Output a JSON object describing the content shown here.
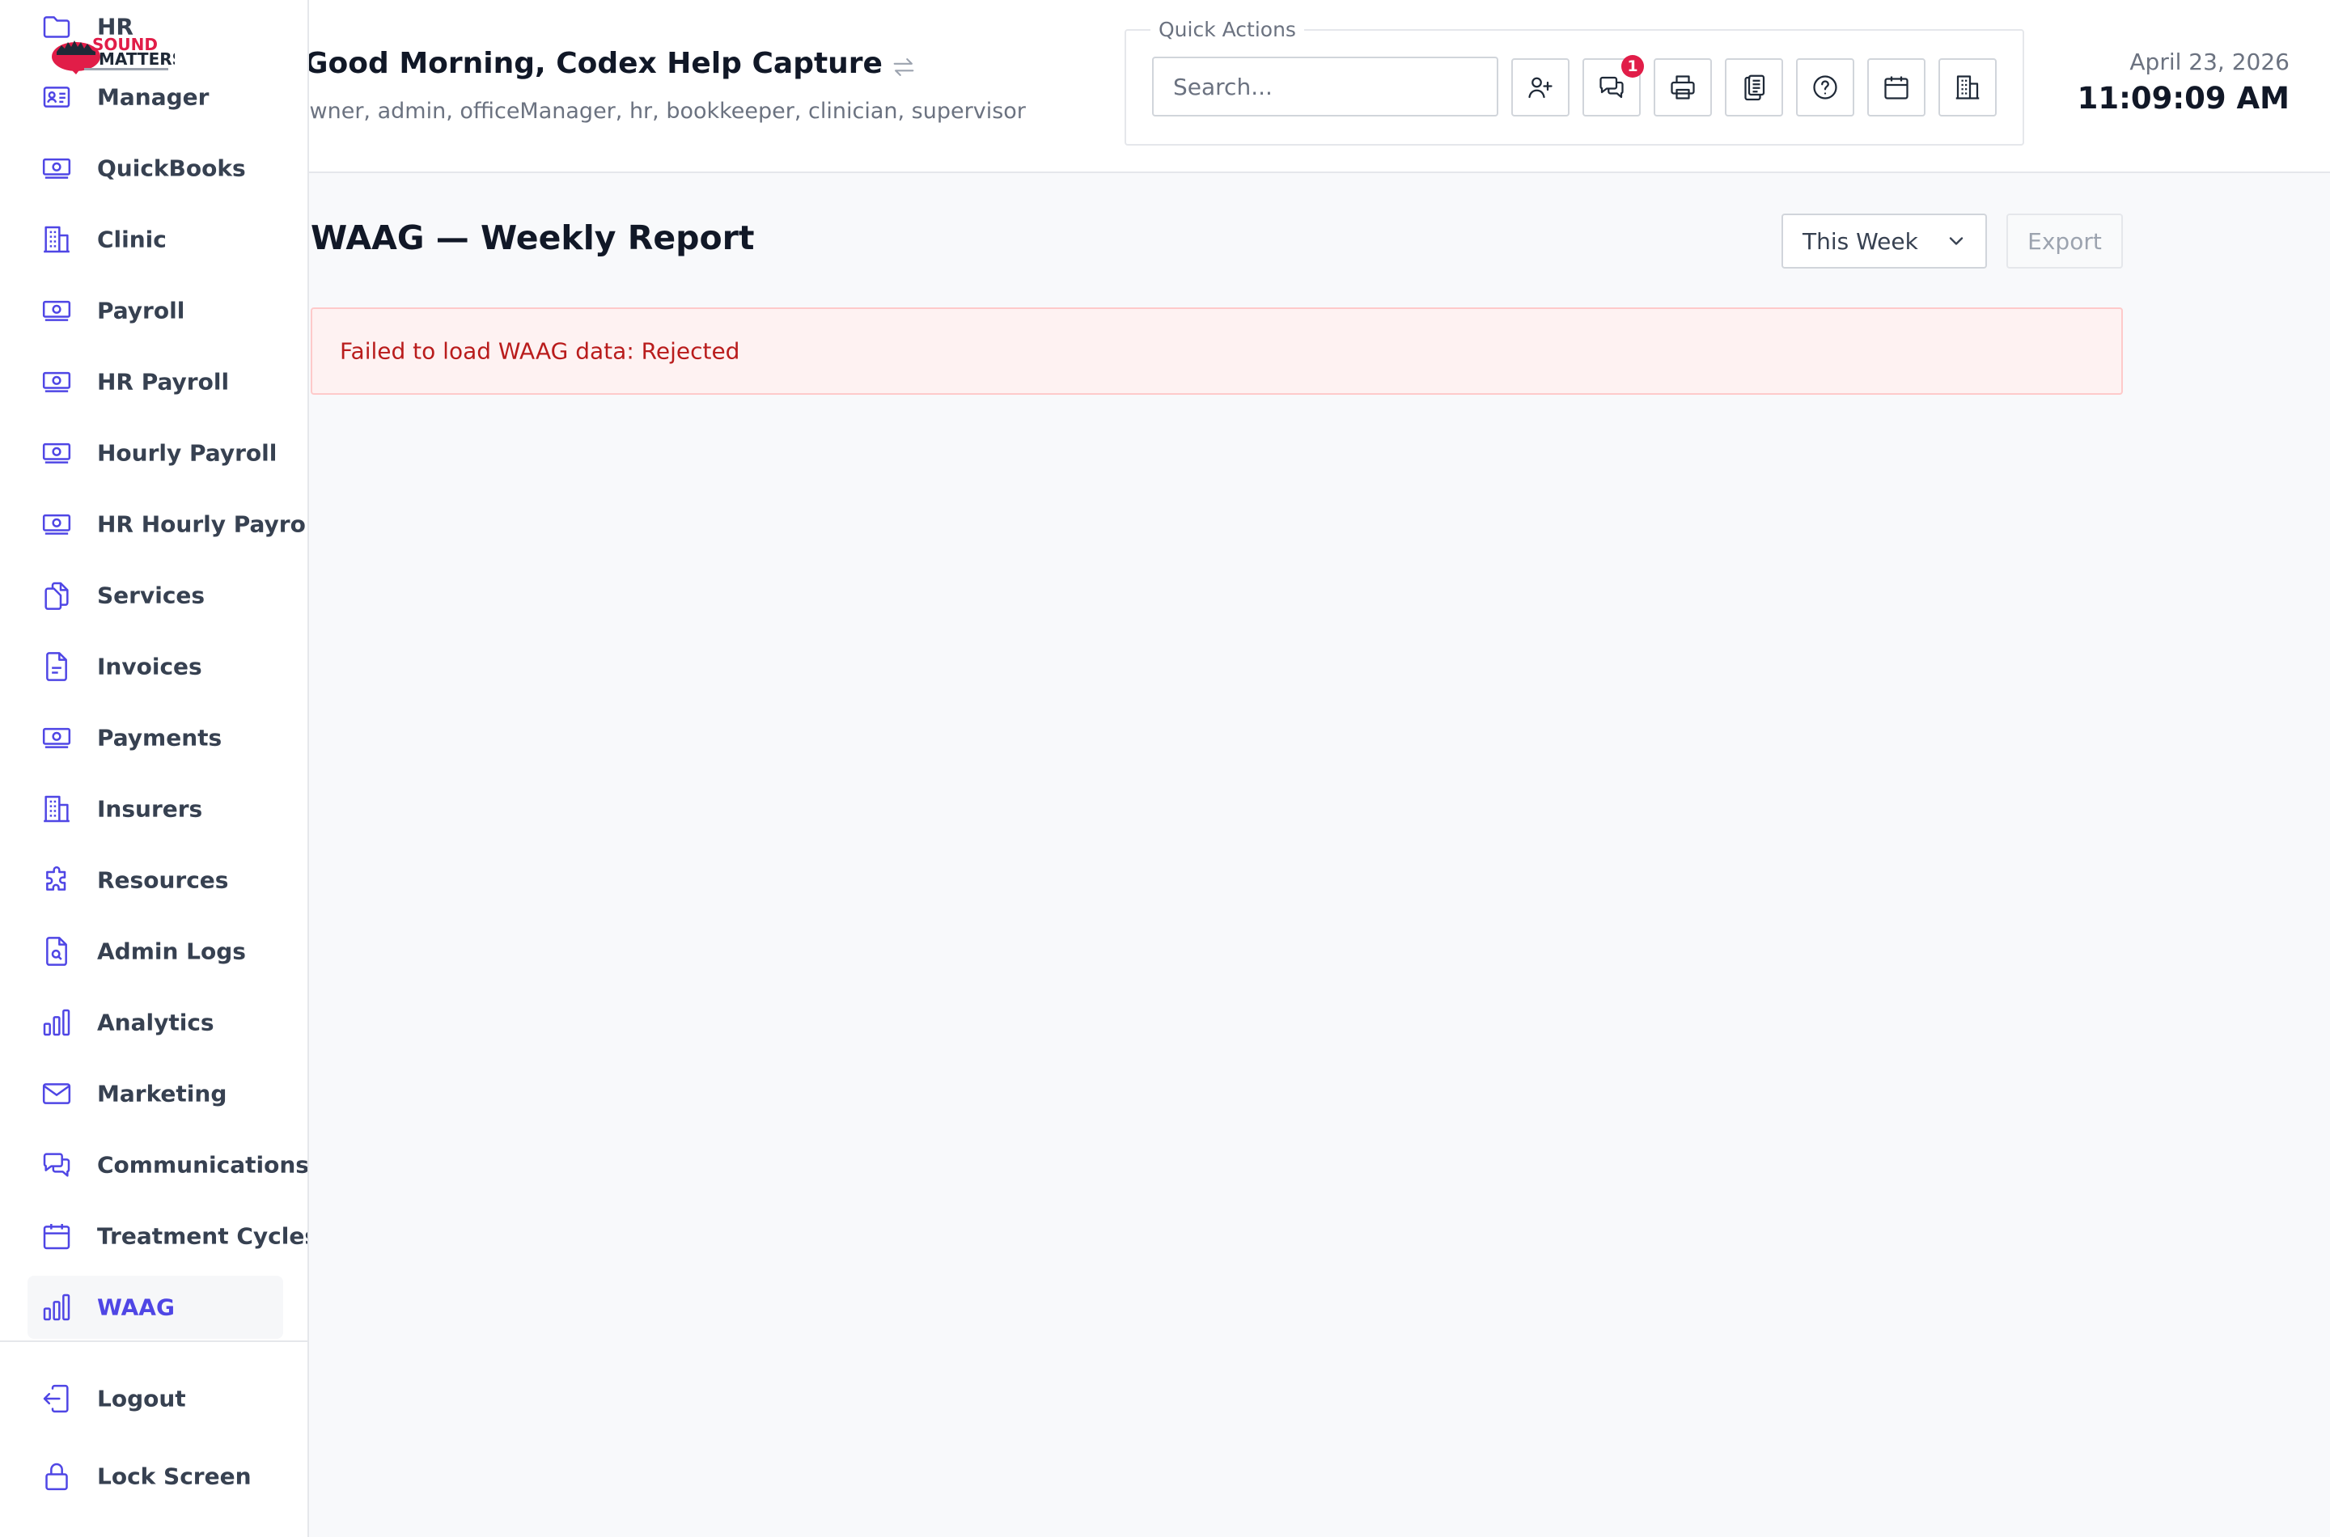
{
  "brand": {
    "logo_line1": "SOUND",
    "logo_line2": "MATTERS",
    "accent_color": "#4f46e5",
    "logo_red": "#e11d48"
  },
  "sidebar": {
    "items": [
      {
        "label": "HR",
        "icon": "folder-icon"
      },
      {
        "label": "Manager",
        "icon": "id-card-icon"
      },
      {
        "label": "QuickBooks",
        "icon": "cash-icon"
      },
      {
        "label": "Clinic",
        "icon": "building-icon"
      },
      {
        "label": "Payroll",
        "icon": "cash-icon"
      },
      {
        "label": "HR Payroll",
        "icon": "cash-icon"
      },
      {
        "label": "Hourly Payroll",
        "icon": "cash-icon"
      },
      {
        "label": "HR Hourly Payroll",
        "icon": "cash-icon"
      },
      {
        "label": "Services",
        "icon": "documents-icon"
      },
      {
        "label": "Invoices",
        "icon": "document-icon"
      },
      {
        "label": "Payments",
        "icon": "cash-icon"
      },
      {
        "label": "Insurers",
        "icon": "building-icon"
      },
      {
        "label": "Resources",
        "icon": "puzzle-icon"
      },
      {
        "label": "Admin Logs",
        "icon": "document-search-icon"
      },
      {
        "label": "Analytics",
        "icon": "bar-chart-icon"
      },
      {
        "label": "Marketing",
        "icon": "mail-icon"
      },
      {
        "label": "Communications",
        "icon": "chat-icon"
      },
      {
        "label": "Treatment Cycles",
        "icon": "calendar-icon"
      },
      {
        "label": "WAAG",
        "icon": "bar-chart-icon",
        "active": true
      }
    ],
    "footer_items": [
      {
        "label": "Logout",
        "icon": "logout-icon"
      },
      {
        "label": "Lock Screen",
        "icon": "lock-icon"
      }
    ]
  },
  "header": {
    "greeting": "Good Morning, Codex Help Capture",
    "roles": "owner, admin, officeManager, hr, bookkeeper, clinician, supervisor",
    "quick_actions": {
      "legend": "Quick Actions",
      "search_placeholder": "Search...",
      "buttons": [
        {
          "icon": "add-user-icon"
        },
        {
          "icon": "chat-icon",
          "badge": "1"
        },
        {
          "icon": "printer-icon"
        },
        {
          "icon": "clipboard-icon"
        },
        {
          "icon": "help-circle-icon"
        },
        {
          "icon": "calendar-icon"
        },
        {
          "icon": "building-icon"
        }
      ]
    },
    "date": "April 23, 2026",
    "time": "11:09:09 AM"
  },
  "main": {
    "title": "WAAG — Weekly Report",
    "period_select": "This Week",
    "export_label": "Export",
    "error_message": "Failed to load WAAG data: Rejected",
    "error_color": "#b91c1c"
  }
}
